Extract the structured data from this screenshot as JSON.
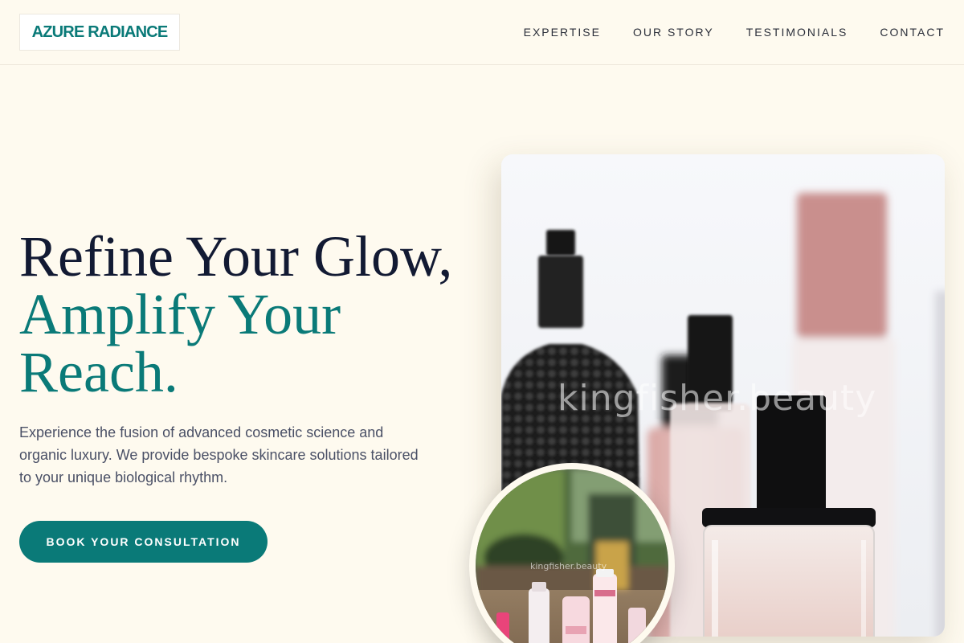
{
  "header": {
    "logo": "AZURE RADIANCE",
    "nav": [
      {
        "label": "EXPERTISE"
      },
      {
        "label": "OUR STORY"
      },
      {
        "label": "TESTIMONIALS"
      },
      {
        "label": "CONTACT"
      }
    ]
  },
  "hero": {
    "title_line1": "Refine Your Glow,",
    "title_line2": "Amplify Your Reach.",
    "description": "Experience the fusion of advanced cosmetic science and organic luxury. We provide bespoke skincare solutions tailored to your unique biological rhythm.",
    "cta_label": "BOOK YOUR CONSULTATION",
    "image_watermark": "kingfisher.beauty",
    "inset_watermark": "kingfisher.beauty"
  },
  "colors": {
    "background": "#fefaef",
    "accent": "#0a7a78",
    "heading": "#121a33",
    "body_text": "#4a5066"
  }
}
